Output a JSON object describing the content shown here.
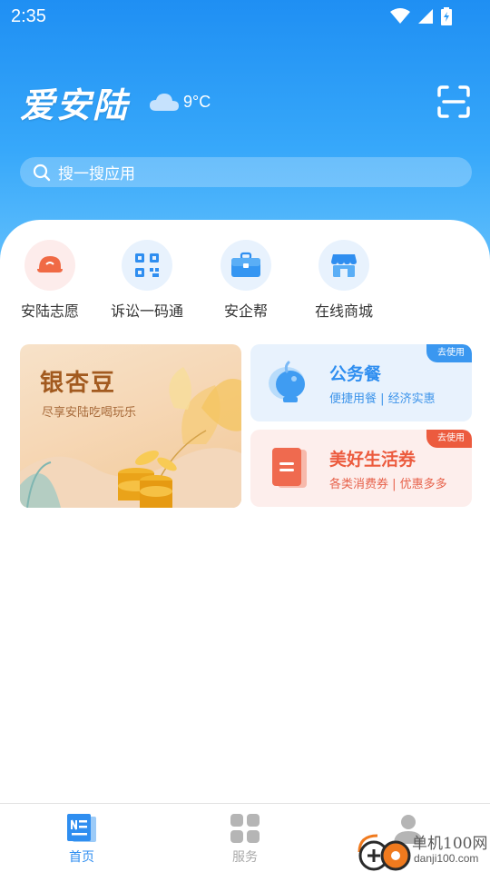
{
  "status_bar": {
    "time": "2:35"
  },
  "header": {
    "app_title": "爱安陆",
    "weather_temp": "9°C",
    "weather_icon": "cloud-icon",
    "scan_icon": "scan-icon"
  },
  "search": {
    "placeholder": "搜一搜应用"
  },
  "quick_actions": [
    {
      "label": "安陆志愿",
      "icon": "volunteer-cap-icon",
      "bg": "#fdecea",
      "color": "#f0643c"
    },
    {
      "label": "诉讼一码通",
      "icon": "qr-code-icon",
      "bg": "#e7f1fd",
      "color": "#2f8ef0"
    },
    {
      "label": "安企帮",
      "icon": "briefcase-icon",
      "bg": "#e7f1fd",
      "color": "#2f8ef0"
    },
    {
      "label": "在线商城",
      "icon": "store-icon",
      "bg": "#e7f1fd",
      "color": "#2f8ef0"
    }
  ],
  "cards": {
    "gingko": {
      "title": "银杏豆",
      "subtitle": "尽享安陆吃喝玩乐"
    },
    "official_meal": {
      "title": "公务餐",
      "subtitle": "便捷用餐 | 经济实惠",
      "badge": "去使用",
      "accent": "#2f8ef0"
    },
    "life_voucher": {
      "title": "美好生活券",
      "subtitle": "各类消费券 | 优惠多多",
      "badge": "去使用",
      "accent": "#ec5b3e"
    }
  },
  "tabbar": {
    "tabs": [
      {
        "label": "首页",
        "icon": "news-icon",
        "active": true
      },
      {
        "label": "服务",
        "icon": "grid-icon",
        "active": false
      },
      {
        "label": "",
        "icon": "profile-icon",
        "active": false
      }
    ],
    "active_color": "#2f8ef0",
    "inactive_color": "#a9a9a9"
  },
  "watermark": {
    "line1": "单机100网",
    "line2": "danji100.com"
  }
}
